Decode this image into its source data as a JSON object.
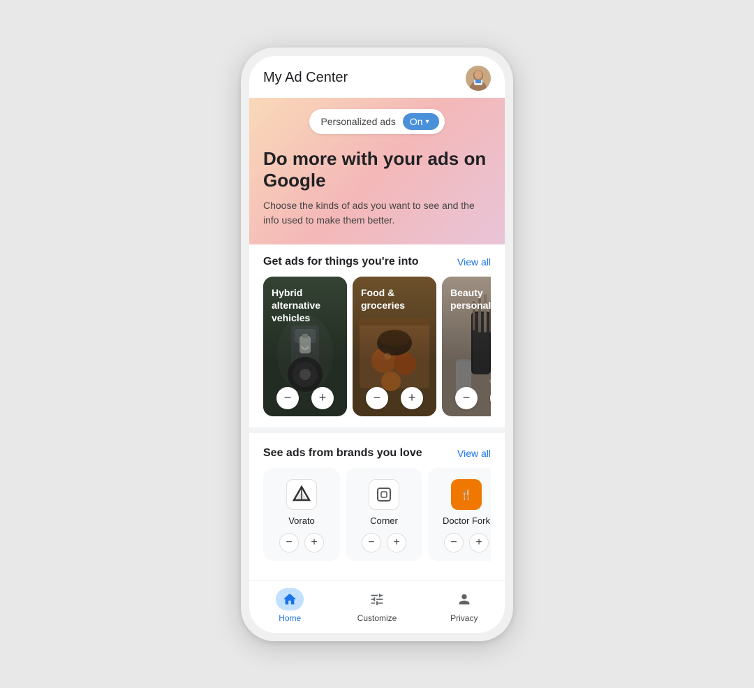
{
  "header": {
    "title": "My Ad Center",
    "avatar_label": "User avatar"
  },
  "personalized_toggle": {
    "label": "Personalized ads",
    "status": "On"
  },
  "hero": {
    "title": "Do more with your ads on Google",
    "subtitle": "Choose the kinds of ads you want to see and the info used to make them better."
  },
  "interests_section": {
    "title": "Get ads for things you're into",
    "view_all": "View all",
    "cards": [
      {
        "label": "Hybrid alternative vehicles",
        "type": "vehicles"
      },
      {
        "label": "Food & groceries",
        "type": "food"
      },
      {
        "label": "Beauty personal care",
        "type": "beauty"
      }
    ]
  },
  "brands_section": {
    "title": "See ads from brands you love",
    "view_all": "View all",
    "brands": [
      {
        "name": "Vorato",
        "type": "vorato"
      },
      {
        "name": "Corner",
        "type": "corner"
      },
      {
        "name": "Doctor Fork",
        "type": "doctorfork"
      }
    ]
  },
  "bottom_nav": {
    "items": [
      {
        "label": "Home",
        "active": true
      },
      {
        "label": "Customize",
        "active": false
      },
      {
        "label": "Privacy",
        "active": false
      }
    ]
  },
  "buttons": {
    "minus": "−",
    "plus": "+"
  }
}
